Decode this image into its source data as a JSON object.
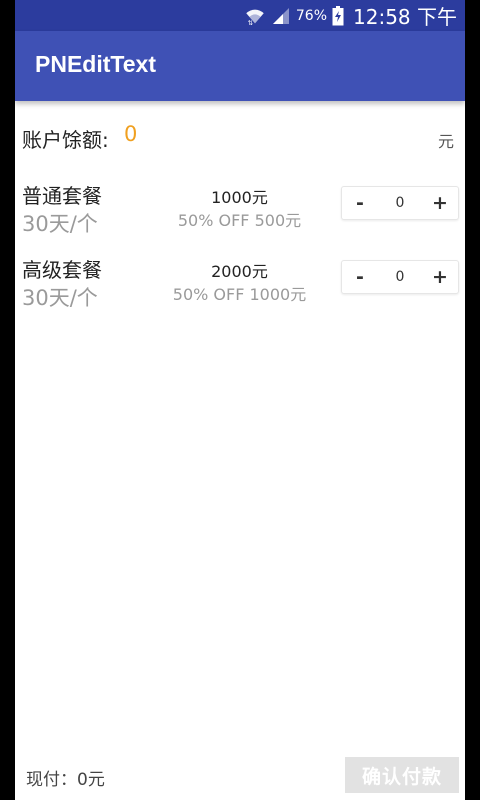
{
  "status_bar": {
    "battery_percent": "76%",
    "time": "12:58 下午",
    "icons": [
      "wifi-icon",
      "signal-icon",
      "battery-charging-icon"
    ]
  },
  "app_bar": {
    "title": "PNEditText"
  },
  "balance": {
    "label": "账户馀额:",
    "value": "0",
    "unit": "元"
  },
  "packages": [
    {
      "name": "普通套餐",
      "period": "30天/个",
      "price": "1000元",
      "discount": "50% OFF 500元",
      "quantity": "0",
      "minus": "-",
      "plus": "+"
    },
    {
      "name": "高级套餐",
      "period": "30天/个",
      "price": "2000元",
      "discount": "50% OFF 1000元",
      "quantity": "0",
      "minus": "-",
      "plus": "+"
    }
  ],
  "footer": {
    "total": "现付：0元",
    "confirm_label": "确认付款"
  },
  "colors": {
    "status_bar": "#2c3c9e",
    "app_bar": "#3f51b5",
    "balance_value": "#f0a020",
    "button_disabled": "#e2e2e2"
  }
}
